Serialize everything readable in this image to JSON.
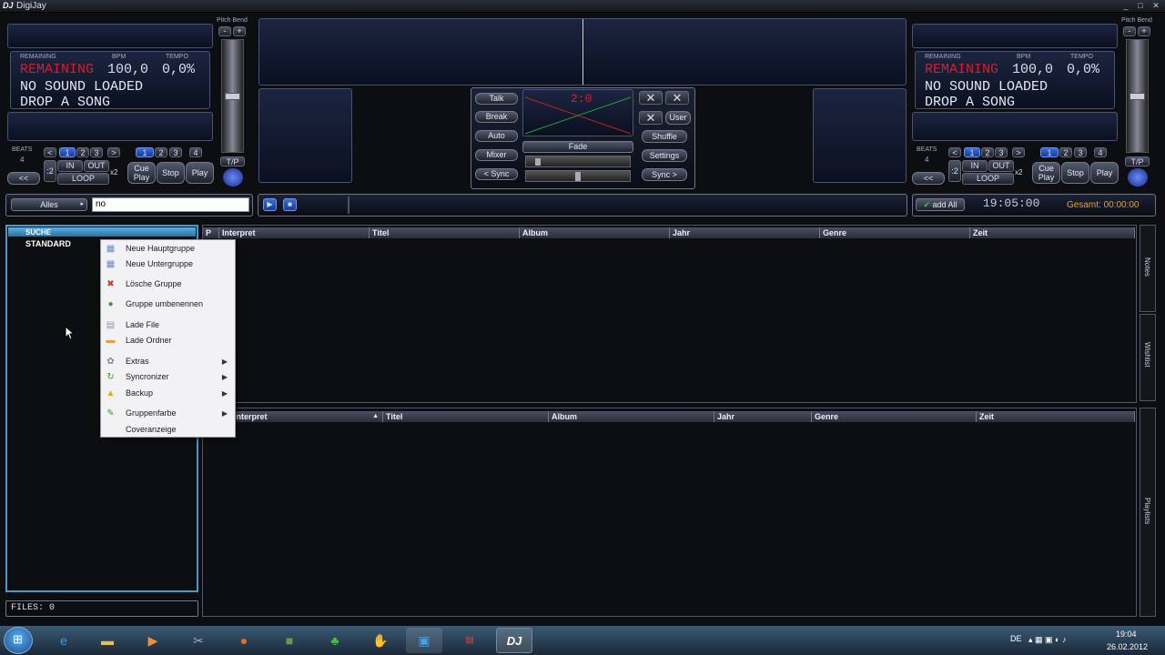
{
  "window": {
    "title": "DigiJay",
    "logo": "DJ",
    "minimize": "_",
    "maximize": "□",
    "close": "✕"
  },
  "deck_left": {
    "pitch_bend": "Pitch Bend",
    "remaining_label": "REMAINING",
    "bpm_label": "BPM",
    "tempo_label": "TEMPO",
    "remaining": "REMAINING",
    "bpm": "100,0",
    "tempo": "0,0%",
    "line1": "NO SOUND LOADED",
    "line2": "DROP A SONG",
    "beats_label": "BEATS",
    "beats_value": "4",
    "minus": "-",
    "plus": "+",
    "nav_prev": "<",
    "nav_next": ">",
    "beat_buttons": [
      "1",
      "2",
      "3",
      "4"
    ],
    "in": "IN",
    "out": "OUT",
    "loop": "LOOP",
    "x2": "x2",
    "half": ":2",
    "rewind": "<<",
    "forward": ">>",
    "cue_play": "Cue\nPlay",
    "stop": "Stop",
    "play": "Play",
    "tp": "T/P"
  },
  "deck_right": {
    "pitch_bend": "Pitch Bend",
    "remaining_label": "REMAINING",
    "bpm_label": "BPM",
    "tempo_label": "TEMPO",
    "remaining": "REMAINING",
    "bpm": "100,0",
    "tempo": "0,0%",
    "line1": "NO SOUND LOADED",
    "line2": "DROP A SONG",
    "beats_label": "BEATS",
    "beats_value": "4",
    "minus": "-",
    "plus": "+",
    "nav_prev": "<",
    "nav_next": ">",
    "beat_buttons": [
      "1",
      "2",
      "3",
      "4"
    ],
    "in": "IN",
    "out": "OUT",
    "loop": "LOOP",
    "x2": "x2",
    "half": ":2",
    "rewind": "<<",
    "forward": ">>",
    "cue_play": "Cue\nPlay",
    "stop": "Stop",
    "play": "Play",
    "tp": "T/P"
  },
  "mixer": {
    "talk": "Talk",
    "break": "Break",
    "auto": "Auto",
    "mixer": "Mixer",
    "sync_left": "< Sync",
    "time": "2:0",
    "fade": "Fade",
    "user": "User",
    "shuffle": "Shuffle",
    "settings": "Settings",
    "sync_right": "Sync >"
  },
  "search": {
    "filter": "Alles",
    "query": "no"
  },
  "clock": {
    "add_all": "add All",
    "time": "19:05:00",
    "total": "Gesamt: 00:00:00"
  },
  "tree": {
    "search": "SUCHE",
    "standard": "STANDARD"
  },
  "files": "FILES: 0",
  "table_top": {
    "columns": [
      "P",
      "Interpret",
      "Titel",
      "Album",
      "Jahr",
      "Genre",
      "Zeit"
    ]
  },
  "table_bottom": {
    "columns": [
      "Interpret",
      "Titel",
      "Album",
      "Jahr",
      "Genre",
      "Zeit"
    ]
  },
  "side_tabs": {
    "notes": "Notes",
    "wishlist": "Wishlist",
    "playlists": "Playlists"
  },
  "context_menu": [
    {
      "label": "Neue Hauptgruppe",
      "icon": "new-main-group-icon",
      "glyph": "▦",
      "color": "#6a8ac8"
    },
    {
      "label": "Neue Untergruppe",
      "icon": "new-subgroup-icon",
      "glyph": "▦",
      "color": "#6a8ac8"
    },
    {
      "label": "Lösche Gruppe",
      "icon": "delete-icon",
      "glyph": "✖",
      "color": "#e03020"
    },
    {
      "label": "Gruppe umbenennen",
      "icon": "rename-icon",
      "glyph": "●",
      "color": "#30a030"
    },
    {
      "label": "Lade File",
      "icon": "file-icon",
      "glyph": "▤",
      "color": "#8898b0"
    },
    {
      "label": "Lade Ordner",
      "icon": "folder-icon",
      "glyph": "▬",
      "color": "#e0a040"
    },
    {
      "label": "Extras",
      "icon": "gear-icon",
      "glyph": "✿",
      "color": "#888",
      "arrow": "▶"
    },
    {
      "label": "Syncronizer",
      "icon": "sync-icon",
      "glyph": "↻",
      "color": "#30a030",
      "arrow": "▶"
    },
    {
      "label": "Backup",
      "icon": "warning-icon",
      "glyph": "▲",
      "color": "#e0b000",
      "arrow": "▶"
    },
    {
      "label": "Gruppenfarbe",
      "icon": "pencil-icon",
      "glyph": "✎",
      "color": "#30a030",
      "arrow": "▶"
    },
    {
      "label": "Coveranzeige",
      "icon": "",
      "glyph": "",
      "color": "#000"
    }
  ],
  "taskbar": {
    "lang": "DE",
    "time": "19:04",
    "date": "26.02.2012"
  }
}
